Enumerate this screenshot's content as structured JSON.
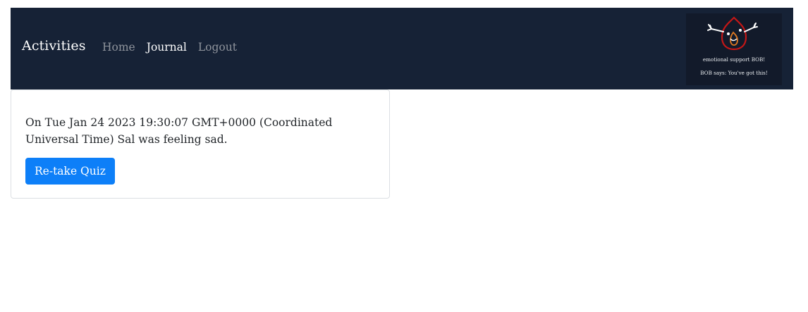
{
  "navbar": {
    "brand": "Activities",
    "links": [
      {
        "label": "Home",
        "active": false
      },
      {
        "label": "Journal",
        "active": true
      },
      {
        "label": "Logout",
        "active": false
      }
    ],
    "logo": {
      "line1": "emotional support BOB!",
      "line2": "BOB says: You've got this!"
    }
  },
  "entry": {
    "text": "On Tue Jan 24 2023 19:30:07 GMT+0000 (Coordinated Universal Time) Sal was feeling sad.",
    "button_label": "Re-take Quiz"
  },
  "colors": {
    "navbar_bg": "#162236",
    "button_bg": "#0d7ff8",
    "logo_mascot": "#c41717"
  }
}
